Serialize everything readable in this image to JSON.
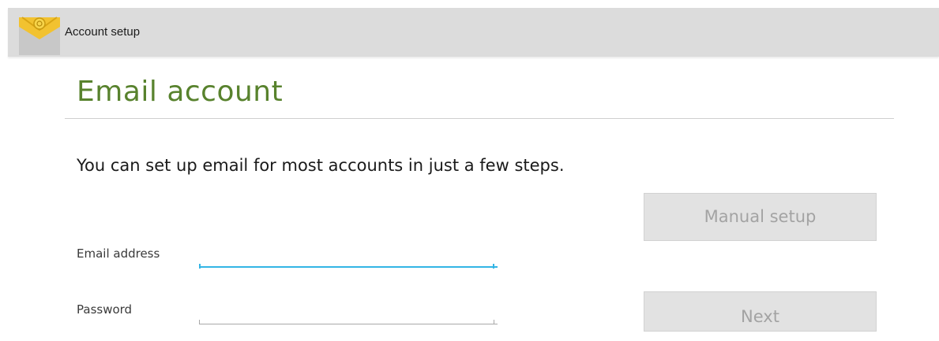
{
  "action_bar": {
    "title": "Account setup",
    "icon": "email-app-icon",
    "colors": {
      "background": "#dcdcdc",
      "icon_yellow": "#f2c230"
    }
  },
  "page": {
    "title": "Email account",
    "title_color": "#58822d",
    "intro": "You can set up email for most accounts in just a few steps."
  },
  "form": {
    "email_label": "Email address",
    "email_value": "",
    "password_label": "Password",
    "password_value": "",
    "focus_color": "#33b5e5"
  },
  "buttons": {
    "manual_setup": "Manual setup",
    "next": "Next"
  }
}
